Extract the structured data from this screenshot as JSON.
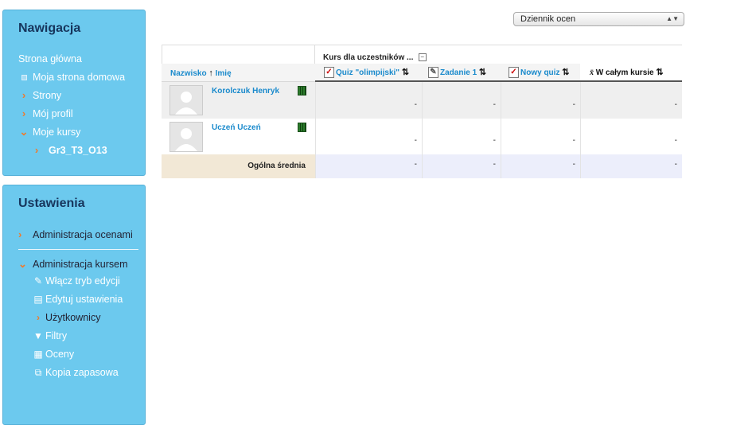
{
  "navigation": {
    "title": "Nawigacja",
    "items": [
      {
        "label": "Strona główna",
        "icon": "none"
      },
      {
        "label": "Moja strona domowa",
        "icon": "square-bullet-icon"
      },
      {
        "label": "Strony",
        "icon": "chevron-right-icon"
      },
      {
        "label": "Mój profil",
        "icon": "chevron-right-icon"
      },
      {
        "label": "Moje kursy",
        "icon": "chevron-down-icon"
      },
      {
        "label": "Gr3_T3_O13",
        "icon": "chevron-right-icon"
      }
    ]
  },
  "settings": {
    "title": "Ustawienia",
    "grade_admin": "Administracja ocenami",
    "course_admin": "Administracja kursem",
    "children": [
      {
        "label": "Włącz tryb edycji",
        "icon": "pencil-edit-icon"
      },
      {
        "label": "Edytuj ustawienia",
        "icon": "document-icon"
      },
      {
        "label": "Użytkownicy",
        "icon": "chevron-right-icon"
      },
      {
        "label": "Filtry",
        "icon": "funnel-icon"
      },
      {
        "label": "Oceny",
        "icon": "grades-table-icon"
      },
      {
        "label": "Kopia zapasowa",
        "icon": "backup-icon"
      }
    ]
  },
  "report_select": {
    "value": "Dziennik ocen"
  },
  "grader": {
    "course_header": "Kurs dla uczestników ...",
    "collapse_symbol": "−",
    "columns": {
      "name_last": "Nazwisko",
      "name_first": "Imię",
      "quiz": "Quiz \"olimpijski\"",
      "task": "Zadanie 1",
      "new_quiz": "Nowy quiz",
      "total": "W całym kursie"
    },
    "rows": [
      {
        "name": "Korolczuk Henryk",
        "quiz": "-",
        "task": "-",
        "new_quiz": "-",
        "total": "-"
      },
      {
        "name": "Uczeń Uczeń",
        "quiz": "-",
        "task": "-",
        "new_quiz": "-",
        "total": "-"
      }
    ],
    "average": {
      "label": "Ogólna średnia",
      "quiz": "-",
      "task": "-",
      "new_quiz": "-",
      "total": "-"
    }
  },
  "colors": {
    "block_bg": "#6cc9ee",
    "link": "#1a8acc",
    "accent_orange": "#f07a2b"
  }
}
